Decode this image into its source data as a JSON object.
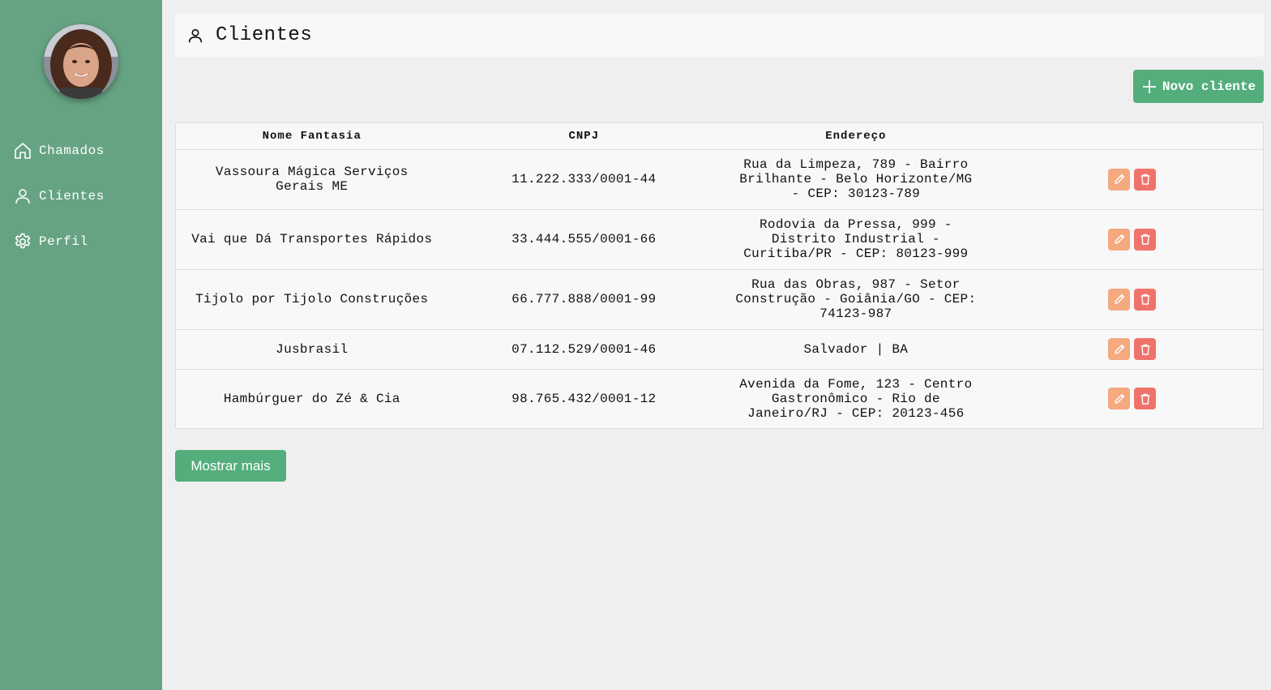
{
  "sidebar": {
    "avatar_alt": "",
    "items": [
      {
        "label": "Chamados",
        "icon": "home-icon"
      },
      {
        "label": "Clientes",
        "icon": "user-icon"
      },
      {
        "label": "Perfil",
        "icon": "gear-icon"
      }
    ]
  },
  "header": {
    "title": "Clientes",
    "icon": "user-icon"
  },
  "actions": {
    "new_client_label": "Novo cliente",
    "show_more_label": "Mostrar mais"
  },
  "table": {
    "columns": [
      "Nome Fantasia",
      "CNPJ",
      "Endereço",
      ""
    ],
    "rows": [
      {
        "name": "Vassoura Mágica Serviços Gerais ME",
        "cnpj": "11.222.333/0001-44",
        "address": "Rua da Limpeza, 789 - Bairro Brilhante - Belo Horizonte/MG - CEP: 30123-789"
      },
      {
        "name": "Vai que Dá Transportes Rápidos",
        "cnpj": "33.444.555/0001-66",
        "address": "Rodovia da Pressa, 999 - Distrito Industrial - Curitiba/PR - CEP: 80123-999"
      },
      {
        "name": "Tijolo por Tijolo Construções",
        "cnpj": "66.777.888/0001-99",
        "address": "Rua das Obras, 987 - Setor Construção - Goiânia/GO - CEP: 74123-987"
      },
      {
        "name": "Jusbrasil",
        "cnpj": "07.112.529/0001-46",
        "address": "Salvador | BA"
      },
      {
        "name": "Hambúrguer do Zé & Cia",
        "cnpj": "98.765.432/0001-12",
        "address": "Avenida da Fome, 123 - Centro Gastronômico - Rio de Janeiro/RJ - CEP: 20123-456"
      }
    ]
  },
  "colors": {
    "sidebar": "#66a383",
    "primary": "#54ae7c",
    "edit": "#f4a97f",
    "delete": "#f0736b",
    "background": "#efefef"
  }
}
